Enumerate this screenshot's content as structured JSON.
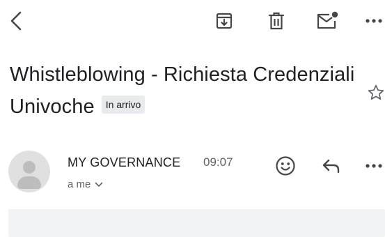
{
  "toolbar": {
    "back_icon": "chevron-left-icon",
    "archive_icon": "archive-icon",
    "delete_icon": "trash-icon",
    "mark_unread_icon": "mail-unread-icon",
    "more_icon": "more-horizontal-icon"
  },
  "message": {
    "subject": "Whistleblowing - Richiesta Credenziali Univoche",
    "label": "In arrivo",
    "star_icon": "star-outline-icon"
  },
  "sender": {
    "avatar_icon": "person-avatar-icon",
    "name": "MY GOVERNANCE",
    "time": "09:07",
    "recipient": "a me",
    "recipient_toggle_icon": "chevron-down-icon",
    "emoji_icon": "smiley-icon",
    "reply_icon": "reply-icon",
    "more_icon": "more-horizontal-icon"
  },
  "colors": {
    "text_primary": "#202124",
    "text_secondary": "#5f6368",
    "icon": "#444746",
    "badge_bg": "#e8eaed",
    "avatar_bg": "#e0e0e0"
  }
}
